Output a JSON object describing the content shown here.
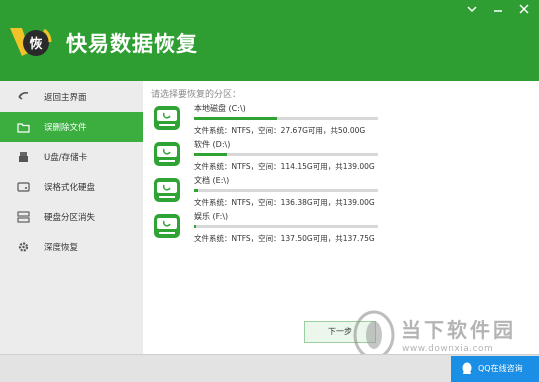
{
  "app": {
    "title": "快易数据恢复",
    "logo_char": "恢",
    "colors": {
      "primary": "#2f9e32",
      "active_item": "#3bae3f",
      "progress": "#2fa334",
      "qq": "#1b8fe5"
    }
  },
  "window_controls": [
    "pin-icon",
    "minimize-icon",
    "close-icon"
  ],
  "sidebar": {
    "items": [
      {
        "label": "返回主界面",
        "icon": "back-arrow-icon"
      },
      {
        "label": "误删除文件",
        "icon": "folder-icon"
      },
      {
        "label": "U盘/存储卡",
        "icon": "usb-drive-icon"
      },
      {
        "label": "误格式化硬盘",
        "icon": "hard-disk-icon"
      },
      {
        "label": "硬盘分区消失",
        "icon": "partition-icon"
      },
      {
        "label": "深度恢复",
        "icon": "gear-icon"
      }
    ],
    "active_index": 1
  },
  "main": {
    "hint": "请选择要恢复的分区：",
    "drives": [
      {
        "name": "本地磁盘 (C:\\)",
        "info": "文件系统：NTFS，空间：27.67G可用，共50.00G",
        "used_fraction": 0.45
      },
      {
        "name": "软件 (D:\\)",
        "info": "文件系统：NTFS，空间：114.15G可用，共139.00G",
        "used_fraction": 0.18
      },
      {
        "name": "文档 (E:\\)",
        "info": "文件系统：NTFS，空间：136.38G可用，共139.00G",
        "used_fraction": 0.02
      },
      {
        "name": "娱乐 (F:\\)",
        "info": "文件系统：NTFS，空间：137.50G可用，共137.75G",
        "used_fraction": 0.01
      }
    ],
    "next_button": "下一步"
  },
  "footer": {
    "qq_label": "QQ在线咨询"
  },
  "watermark": {
    "text": "当下软件园",
    "url": "www.downxia.com"
  }
}
